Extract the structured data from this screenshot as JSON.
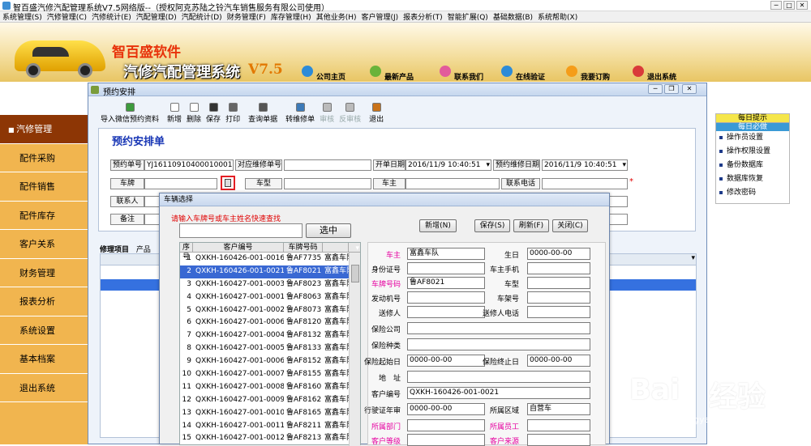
{
  "app": {
    "title": "智百盛汽修汽配管理系统V7.5网络版--（授权阿克苏陆之铃汽车销售服务有限公司使用）"
  },
  "menu": [
    "系统管理(S)",
    "汽修管理(C)",
    "汽修统计(E)",
    "汽配管理(D)",
    "汽配统计(D)",
    "财务管理(F)",
    "库存管理(H)",
    "其他业务(H)",
    "客户管理(J)",
    "报表分析(T)",
    "智能扩展(Q)",
    "基础数据(B)",
    "系统帮助(X)"
  ],
  "banner": {
    "brand": "智百盛软件",
    "product": "汽修汽配管理系统",
    "version": "V7.5",
    "nav": [
      "公司主页",
      "最新产品",
      "联系我们",
      "在线验证",
      "我要订购",
      "退出系统"
    ]
  },
  "sidebar": {
    "items": [
      "汽修管理",
      "配件采购",
      "配件销售",
      "配件库存",
      "客户关系",
      "财务管理",
      "报表分析",
      "系统设置",
      "基本档案",
      "退出系统"
    ],
    "active": 0
  },
  "tips": {
    "header": "每日提示",
    "sub": "每日必做",
    "items": [
      "操作员设置",
      "操作权限设置",
      "备份数据库",
      "数据库恢复",
      "修改密码"
    ]
  },
  "window": {
    "title": "预约安排",
    "toolbar": [
      "导入微信预约资料",
      "新增",
      "删除",
      "保存",
      "打印",
      "查询单据",
      "转维修单",
      "审核",
      "反审核",
      "退出"
    ],
    "form_title": "预约安排单",
    "fields": {
      "booking_no_label": "预约单号",
      "booking_no": "YJ16110910400010001",
      "repair_no_label": "对应维修单号",
      "open_date_label": "开单日期",
      "open_date": "2016/11/9  10:40:51",
      "repair_date_label": "预约维修日期",
      "repair_date": "2016/11/9  10:40:51",
      "plate_label": "车牌",
      "model_label": "车型",
      "owner_label": "车主",
      "phone_label": "联系电话",
      "contact_label": "联系人",
      "remark_label": "备注"
    },
    "tabs": [
      "修理项目",
      "产品"
    ]
  },
  "dialog": {
    "title": "车辆选择",
    "hint": "请输入车牌号或车主姓名快速查找",
    "search_value": "",
    "buttons": {
      "select": "选中",
      "new": "新增(N)",
      "save": "保存(S)",
      "refresh": "刷新(F)",
      "close": "关闭(C)"
    },
    "columns": [
      "序号",
      "客户编号",
      "车牌号码",
      ""
    ],
    "rows": [
      {
        "no": "1",
        "cust": "QXKH-160426-001-0016",
        "plate": "鲁AF7735",
        "owner": "富鑫车队"
      },
      {
        "no": "2",
        "cust": "QXKH-160426-001-0021",
        "plate": "鲁AF8021",
        "owner": "富鑫车队"
      },
      {
        "no": "3",
        "cust": "QXKH-160427-001-0003",
        "plate": "鲁AF8023",
        "owner": "富鑫车队"
      },
      {
        "no": "4",
        "cust": "QXKH-160427-001-0001",
        "plate": "鲁AF8063",
        "owner": "富鑫车队"
      },
      {
        "no": "5",
        "cust": "QXKH-160427-001-0002",
        "plate": "鲁AF8073",
        "owner": "富鑫车队"
      },
      {
        "no": "6",
        "cust": "QXKH-160427-001-0006",
        "plate": "鲁AF8120",
        "owner": "富鑫车队"
      },
      {
        "no": "7",
        "cust": "QXKH-160427-001-0004",
        "plate": "鲁AF8132",
        "owner": "富鑫车队"
      },
      {
        "no": "8",
        "cust": "QXKH-160427-001-0005",
        "plate": "鲁AF8133",
        "owner": "富鑫车队"
      },
      {
        "no": "9",
        "cust": "QXKH-160427-001-0006",
        "plate": "鲁AF8152",
        "owner": "富鑫车队"
      },
      {
        "no": "10",
        "cust": "QXKH-160427-001-0007",
        "plate": "鲁AF8155",
        "owner": "富鑫车队"
      },
      {
        "no": "11",
        "cust": "QXKH-160427-001-0008",
        "plate": "鲁AF8160",
        "owner": "富鑫车队"
      },
      {
        "no": "12",
        "cust": "QXKH-160427-001-0009",
        "plate": "鲁AF8162",
        "owner": "富鑫车队"
      },
      {
        "no": "13",
        "cust": "QXKH-160427-001-0010",
        "plate": "鲁AF8165",
        "owner": "富鑫车队"
      },
      {
        "no": "14",
        "cust": "QXKH-160427-001-0011",
        "plate": "鲁AF8211",
        "owner": "富鑫车队"
      },
      {
        "no": "15",
        "cust": "QXKH-160427-001-0012",
        "plate": "鲁AF8213",
        "owner": "富鑫车队"
      }
    ],
    "selected_row": 1,
    "detail": {
      "owner_label": "车主",
      "owner": "富鑫车队",
      "birthday_label": "生日",
      "birthday": "0000-00-00",
      "idcard_label": "身份证号",
      "idcard": "",
      "mobile_label": "车主手机",
      "mobile": "",
      "plate_label": "车牌号码",
      "plate": "鲁AF8021",
      "model_label": "车型",
      "model": "",
      "engine_label": "发动机号",
      "engine": "",
      "frame_label": "车架号",
      "frame": "",
      "sender_label": "送修人",
      "sender": "",
      "sender_phone_label": "送修人电话",
      "sender_phone": "",
      "insurer_label": "保险公司",
      "insurer": "",
      "ins_type_label": "保险种类",
      "ins_type": "",
      "ins_start_label": "保险起始日",
      "ins_start": "0000-00-00",
      "ins_end_label": "保险终止日",
      "ins_end": "0000-00-00",
      "address_label": "地　址",
      "address": "",
      "cust_no_label": "客户编号",
      "cust_no": "QXKH-160426-001-0021",
      "license_label": "行驶证年审",
      "license": "0000-00-00",
      "region_label": "所属区域",
      "region": "自营车",
      "dept_label": "所属部门",
      "dept": "",
      "staff_label": "所属员工",
      "staff": "",
      "level_label": "客户等级",
      "level": "",
      "source_label": "客户来源",
      "source": ""
    }
  },
  "watermark": {
    "text1": "Bai",
    "text2": "经验",
    "url": "jingyan.baidu.com"
  },
  "colors": {
    "sidebar": "#f1b54f",
    "sidebar_active": "#8d3605",
    "selection": "#3968d3",
    "pink_label": "#e600a0",
    "title_blue": "#1836b5",
    "highlight_red": "#e31e24"
  }
}
